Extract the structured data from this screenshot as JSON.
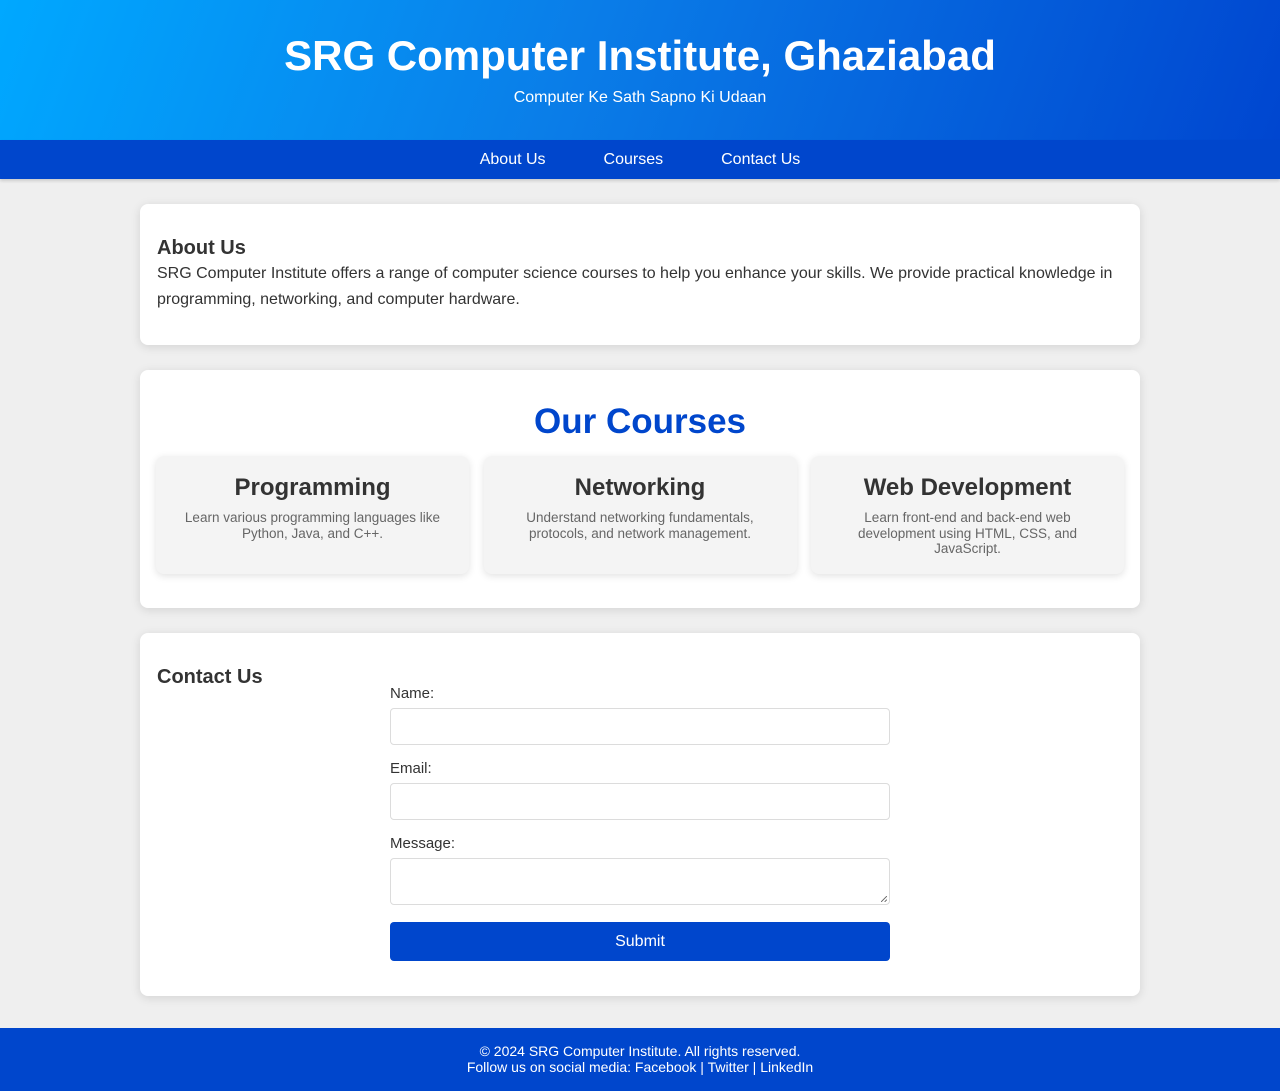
{
  "header": {
    "title": "SRG Computer Institute, Ghaziabad",
    "tagline": "Computer Ke Sath Sapno Ki Udaan"
  },
  "nav": {
    "items": [
      {
        "label": "About Us"
      },
      {
        "label": "Courses"
      },
      {
        "label": "Contact Us"
      }
    ]
  },
  "about": {
    "heading": "About Us",
    "text": "SRG Computer Institute offers a range of computer science courses to help you enhance your skills. We provide practical knowledge in programming, networking, and computer hardware."
  },
  "courses": {
    "heading": "Our Courses",
    "items": [
      {
        "title": "Programming",
        "description": "Learn various programming languages like Python, Java, and C++."
      },
      {
        "title": "Networking",
        "description": "Understand networking fundamentals, protocols, and network management."
      },
      {
        "title": "Web Development",
        "description": "Learn front-end and back-end web development using HTML, CSS, and JavaScript."
      }
    ]
  },
  "contact": {
    "heading": "Contact Us",
    "name_label": "Name:",
    "name_value": "",
    "email_label": "Email:",
    "email_value": "",
    "message_label": "Message:",
    "message_value": "",
    "submit_label": "Submit"
  },
  "footer": {
    "copyright": "© 2024 SRG Computer Institute. All rights reserved.",
    "social_prefix": "Follow us on social media: ",
    "links": [
      "Facebook",
      "Twitter",
      "LinkedIn"
    ],
    "separator": " | "
  },
  "colors": {
    "primary": "#0046cc",
    "header_gradient_start": "#00a8ff",
    "page_background": "#efefef"
  }
}
